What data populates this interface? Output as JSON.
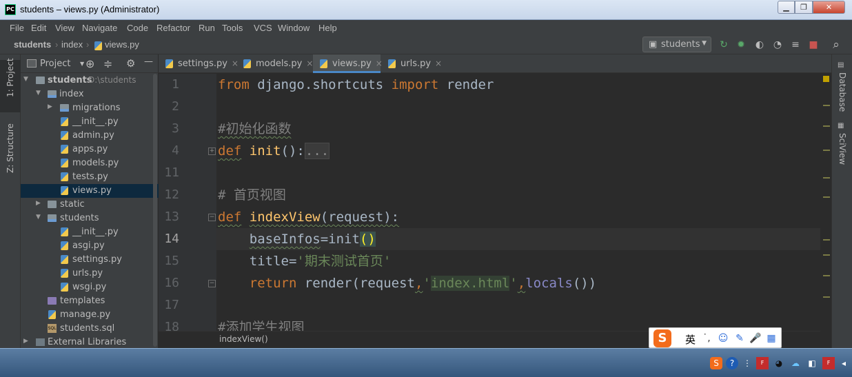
{
  "window": {
    "title": "students – views.py (Administrator)",
    "logo": "PC",
    "min": "▁",
    "max": "❐",
    "close": "✕"
  },
  "menu": [
    "File",
    "Edit",
    "View",
    "Navigate",
    "Code",
    "Refactor",
    "Run",
    "Tools",
    "VCS",
    "Window",
    "Help"
  ],
  "nav": {
    "project": "students",
    "folder": "index",
    "file": "views.py",
    "run_config": "students",
    "run_config_arrow": "▼"
  },
  "left_tabs": {
    "project": "1: Project",
    "structure": "Z: Structure"
  },
  "right_tabs": {
    "database": "Database",
    "sciview": "SciView"
  },
  "project_panel": {
    "title": "Project",
    "title_arrow": "▼",
    "tree": [
      {
        "label": "students",
        "hint": "D:\\students",
        "arrow": "▼"
      },
      {
        "label": "index",
        "arrow": "▼"
      },
      {
        "label": "migrations",
        "arrow": "▶"
      },
      {
        "label": "__init__.py"
      },
      {
        "label": "admin.py"
      },
      {
        "label": "apps.py"
      },
      {
        "label": "models.py"
      },
      {
        "label": "tests.py"
      },
      {
        "label": "views.py"
      },
      {
        "label": "static",
        "arrow": "▶"
      },
      {
        "label": "students",
        "arrow": "▼"
      },
      {
        "label": "__init__.py"
      },
      {
        "label": "asgi.py"
      },
      {
        "label": "settings.py"
      },
      {
        "label": "urls.py"
      },
      {
        "label": "wsgi.py"
      },
      {
        "label": "templates"
      },
      {
        "label": "manage.py"
      },
      {
        "label": "students.sql",
        "icon_text": "SQL"
      },
      {
        "label": "External Libraries",
        "arrow": "▶"
      }
    ]
  },
  "tabs": [
    {
      "label": "settings.py",
      "close": "×"
    },
    {
      "label": "models.py",
      "close": "×"
    },
    {
      "label": "views.py",
      "close": "×"
    },
    {
      "label": "urls.py",
      "close": "×"
    }
  ],
  "editor": {
    "line_numbers": [
      "1",
      "2",
      "3",
      "4",
      "11",
      "12",
      "13",
      "14",
      "15",
      "16",
      "17",
      "18"
    ],
    "fold_marks": {
      "collapsed": "+",
      "open": "−"
    },
    "line1": {
      "kw_from": "from",
      "module": " django.shortcuts ",
      "kw_import": "import",
      "name": " render"
    },
    "line3": {
      "comment": "#初始化函数"
    },
    "line4": {
      "kw": "def",
      "fn": "init",
      "paren": "():",
      "folded": "..."
    },
    "line12": {
      "comment": "# 首页视图"
    },
    "line13": {
      "kw": "def",
      "fn": "indexView",
      "args": "(request):"
    },
    "line14": {
      "indent": "    ",
      "var": "baseInfos",
      "eq": "=init",
      "paren": "()"
    },
    "line15": {
      "indent": "    ",
      "var": "title",
      "eq": "=",
      "str": "'期末测试首页'"
    },
    "line16": {
      "indent": "    ",
      "kw": "return",
      "call": " render(request",
      "comma1": ",",
      "q1": "'",
      "str": "index.html",
      "q2": "'",
      "comma2": ",",
      "builtin": "locals",
      "end": "())"
    },
    "line18": {
      "comment": "#添加学生视图"
    },
    "breadcrumb": "indexView()"
  },
  "ime": {
    "logo": "S",
    "lang": "英",
    "punct": "˙,",
    "emoji": "☺",
    "pen": "✎",
    "mic": "🎤",
    "grid": "▦"
  },
  "toolbar_icons": {
    "config": "▣",
    "run": "↻",
    "debug": "✹",
    "coverage": "◐",
    "profile": "◔",
    "build": "≡",
    "stop": "■",
    "search": "⌕"
  },
  "project_icons": {
    "target": "⊕",
    "collapse": "≑",
    "gear": "⚙",
    "minimize": "—"
  },
  "colors": {
    "keyword": "#cc7832",
    "function": "#ffc66d",
    "comment": "#808080",
    "string": "#6a8759",
    "builtin": "#8888c6",
    "text": "#a9b7c6"
  }
}
